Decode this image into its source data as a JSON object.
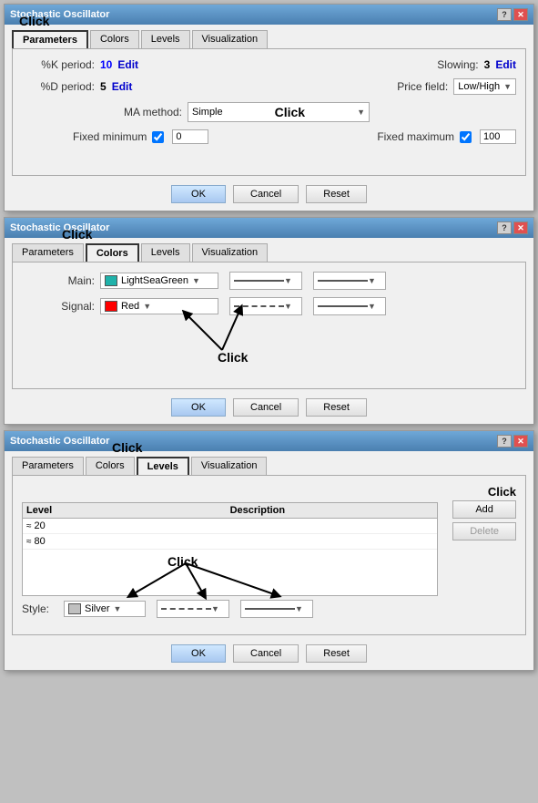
{
  "dialogs": [
    {
      "id": "dialog-parameters",
      "title": "Stochastic Oscillator",
      "tabs": [
        {
          "label": "Parameters",
          "active": true
        },
        {
          "label": "Colors",
          "active": false
        },
        {
          "label": "Levels",
          "active": false
        },
        {
          "label": "Visualization",
          "active": false
        }
      ],
      "annotation": "Click",
      "active_tab": "Parameters",
      "fields": {
        "k_period_label": "%K period:",
        "k_period_value": "10",
        "k_period_edit": "Edit",
        "slowing_label": "Slowing:",
        "slowing_value": "3",
        "slowing_edit": "Edit",
        "d_period_label": "%D period:",
        "d_period_value": "5",
        "d_period_edit": "Edit",
        "price_field_label": "Price field:",
        "price_field_value": "Low/High",
        "ma_method_label": "MA method:",
        "ma_method_value": "Simple",
        "ma_method_annotation": "Click",
        "fixed_min_label": "Fixed minimum",
        "fixed_min_value": "0",
        "fixed_max_label": "Fixed maximum",
        "fixed_max_value": "100"
      },
      "buttons": [
        "OK",
        "Cancel",
        "Reset"
      ]
    },
    {
      "id": "dialog-colors",
      "title": "Stochastic Oscillator",
      "tabs": [
        {
          "label": "Parameters",
          "active": false
        },
        {
          "label": "Colors",
          "active": true
        },
        {
          "label": "Levels",
          "active": false
        },
        {
          "label": "Visualization",
          "active": false
        }
      ],
      "annotation": "Click",
      "active_tab": "Colors",
      "fields": {
        "main_label": "Main:",
        "main_color": "LightSeaGreen",
        "main_color_hex": "#20b2aa",
        "signal_label": "Signal:",
        "signal_color": "Red",
        "signal_color_hex": "#ff0000"
      },
      "click_annotation": "Click",
      "buttons": [
        "OK",
        "Cancel",
        "Reset"
      ]
    },
    {
      "id": "dialog-levels",
      "title": "Stochastic Oscillator",
      "tabs": [
        {
          "label": "Parameters",
          "active": false
        },
        {
          "label": "Colors",
          "active": false
        },
        {
          "label": "Levels",
          "active": true
        },
        {
          "label": "Visualization",
          "active": false
        }
      ],
      "annotation": "Click",
      "active_tab": "Levels",
      "fields": {
        "level_header": "Level",
        "description_header": "Description",
        "level1": "20",
        "level2": "80",
        "style_label": "Style:",
        "style_color": "Silver",
        "style_color_hex": "#c0c0c0"
      },
      "click_annotation": "Click",
      "side_buttons": [
        "Add",
        "Delete"
      ],
      "buttons": [
        "OK",
        "Cancel",
        "Reset"
      ]
    }
  ]
}
